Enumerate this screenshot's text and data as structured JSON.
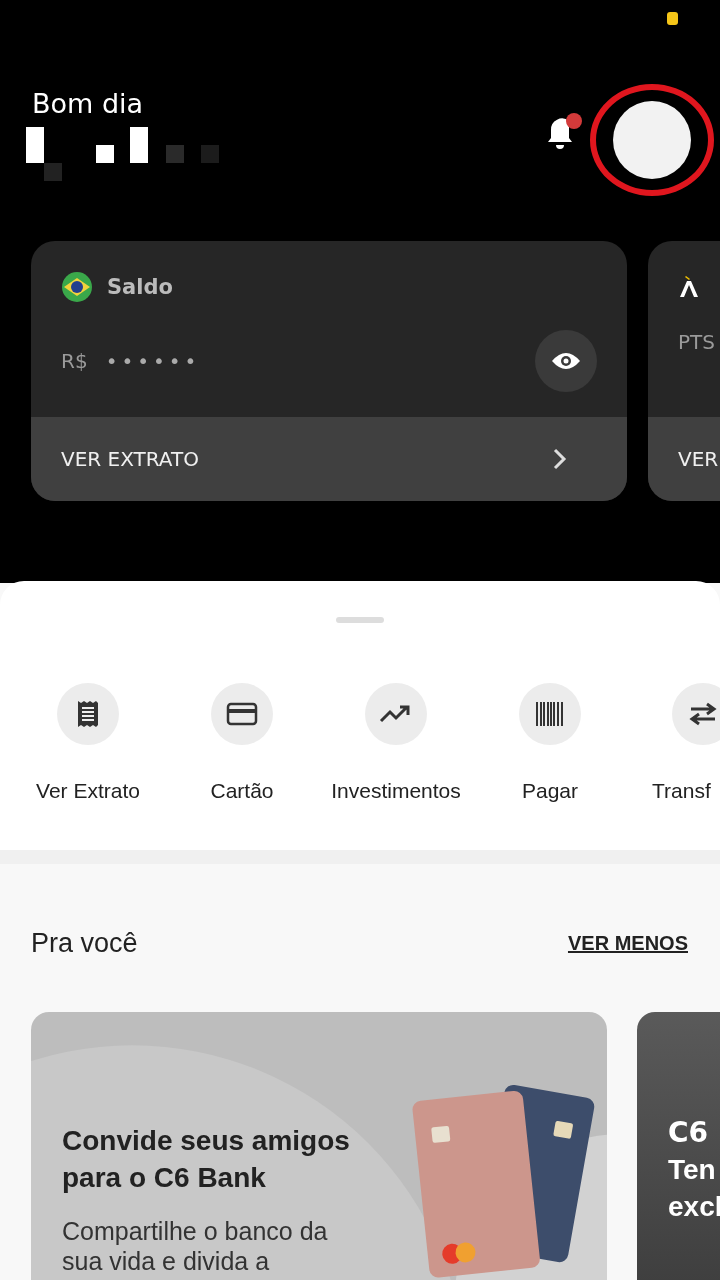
{
  "greeting": "Bom dia",
  "notifications": {
    "unread": true
  },
  "accounts": [
    {
      "kind": "balance",
      "title": "Saldo",
      "currency": "R$",
      "masked_value": "••••••",
      "action": "VER EXTRATO"
    },
    {
      "kind": "points",
      "currency": "PTS",
      "action": "VER"
    }
  ],
  "shortcuts": [
    {
      "kind": "statement",
      "label": "Ver Extrato"
    },
    {
      "kind": "card",
      "label": "Cartão"
    },
    {
      "kind": "invest",
      "label": "Investimentos"
    },
    {
      "kind": "pay",
      "label": "Pagar"
    },
    {
      "kind": "transfer",
      "label": "Transf"
    }
  ],
  "for_you": {
    "title": "Pra você",
    "toggle": "VER MENOS"
  },
  "promos": [
    {
      "kind": "invite",
      "title": "Convide seus amigos para o C6 Bank",
      "body": "Compartilhe o banco da sua vida e divida a"
    },
    {
      "kind": "exclusive",
      "brand": "C6",
      "title_lines": [
        "Ten",
        "excl"
      ]
    }
  ]
}
